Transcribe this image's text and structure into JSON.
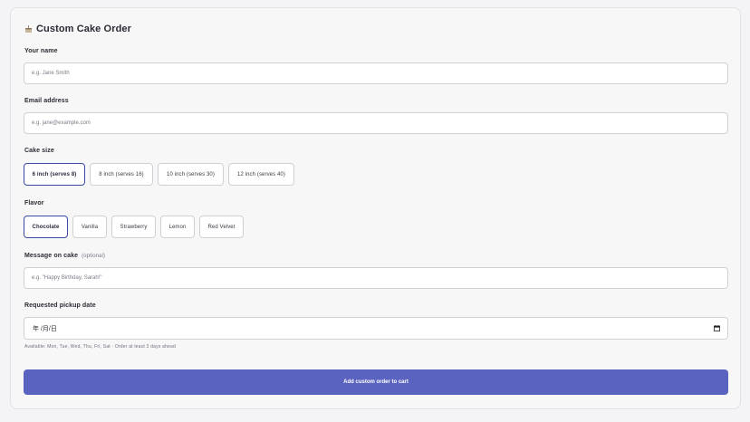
{
  "form": {
    "title": "Custom Cake Order",
    "title_icon": "cake-icon",
    "name": {
      "label": "Your name",
      "placeholder": "e.g. Jane Smith"
    },
    "email": {
      "label": "Email address",
      "placeholder": "e.g. jane@example.com"
    },
    "size": {
      "label": "Cake size",
      "options": [
        "6 inch (serves 8)",
        "8 inch (serves 16)",
        "10 inch (serves 30)",
        "12 inch (serves 40)"
      ],
      "selected": "6 inch (serves 8)"
    },
    "flavor": {
      "label": "Flavor",
      "options": [
        "Chocolate",
        "Vanilla",
        "Strawberry",
        "Lemon",
        "Red Velvet"
      ],
      "selected": "Chocolate"
    },
    "message": {
      "label": "Message on cake",
      "optional": "(optional)",
      "placeholder": "e.g. \"Happy Birthday, Sarah!\""
    },
    "pickup": {
      "label": "Requested pickup date",
      "value": "年 /月/日",
      "icon": "calendar-icon",
      "hint": "Available: Mon, Tue, Wed, Thu, Fri, Sat · Order at least 3 days ahead"
    },
    "submit_label": "Add custom order to cart"
  },
  "colors": {
    "accent": "#5a64c0",
    "selected_border": "#3b4aa6"
  }
}
